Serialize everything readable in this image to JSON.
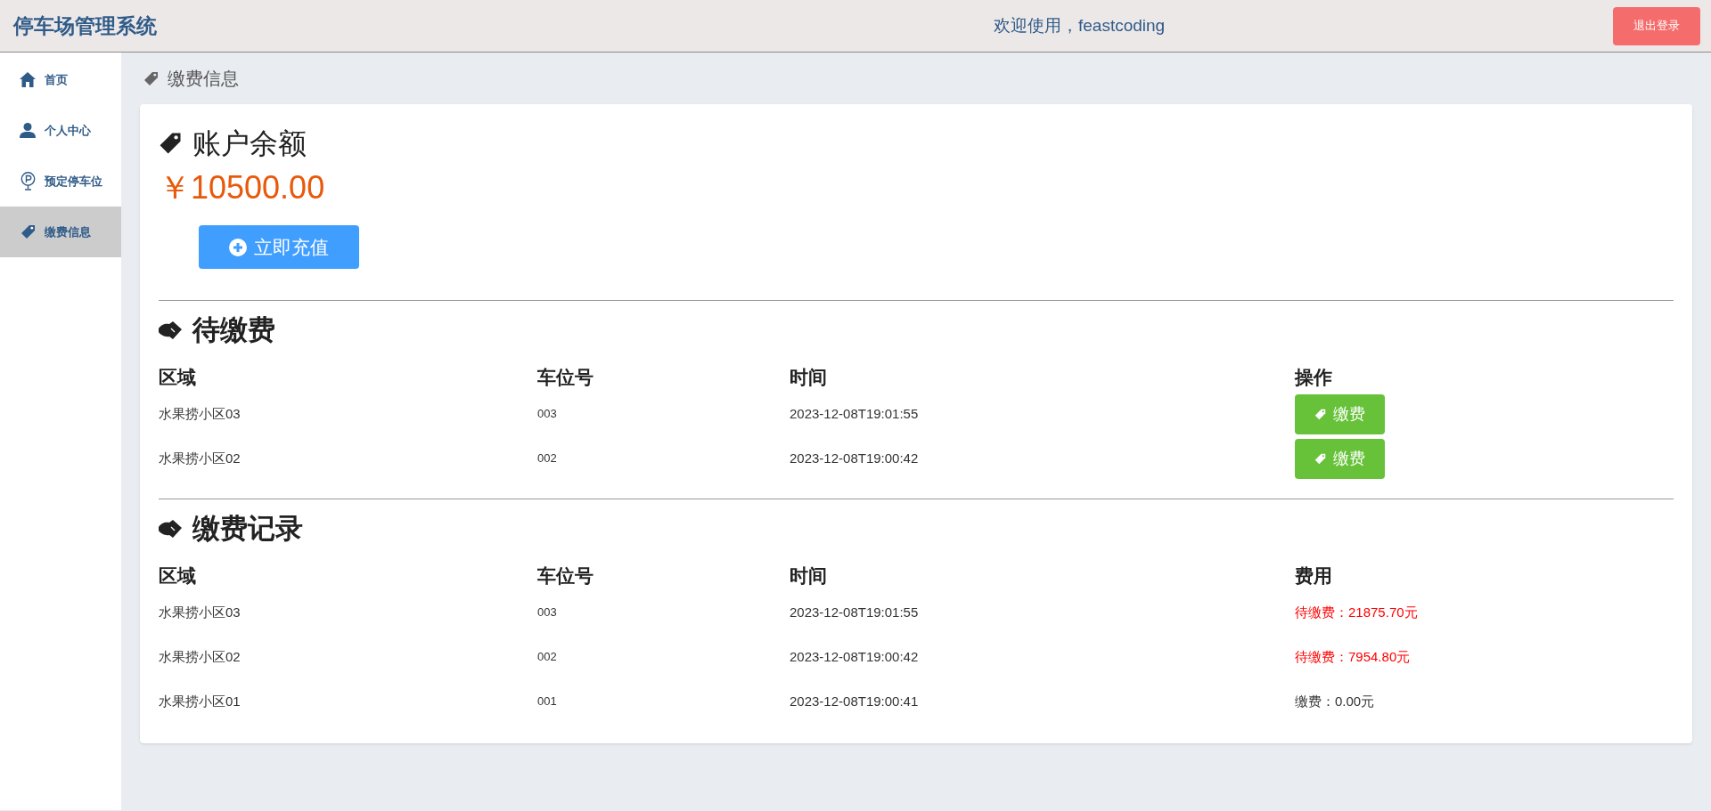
{
  "header": {
    "title": "停车场管理系统",
    "welcome": "欢迎使用，feastcoding",
    "logout_button": "退出登录"
  },
  "sidebar": {
    "items": [
      {
        "label": "首页",
        "kind": "home",
        "selected": false
      },
      {
        "label": "个人中心",
        "kind": "user",
        "selected": false
      },
      {
        "label": "预定停车位",
        "kind": "parking",
        "selected": false
      },
      {
        "label": "缴费信息",
        "kind": "tag",
        "selected": true
      }
    ]
  },
  "page_title": "缴费信息",
  "balance": {
    "title": "账户余额",
    "amount": "￥10500.00",
    "recharge_button": "立即充值"
  },
  "pending": {
    "title": "待缴费",
    "columns": [
      "区域",
      "车位号",
      "时间",
      "操作"
    ],
    "rows": [
      {
        "area": "水果捞小区03",
        "space": "003",
        "time": "2023-12-08T19:01:55",
        "action": "缴费"
      },
      {
        "area": "水果捞小区02",
        "space": "002",
        "time": "2023-12-08T19:00:42",
        "action": "缴费"
      }
    ]
  },
  "records": {
    "title": "缴费记录",
    "columns": [
      "区域",
      "车位号",
      "时间",
      "费用"
    ],
    "rows": [
      {
        "area": "水果捞小区03",
        "space": "003",
        "time": "2023-12-08T19:01:55",
        "fee": "待缴费：21875.70元",
        "unpaid": true
      },
      {
        "area": "水果捞小区02",
        "space": "002",
        "time": "2023-12-08T19:00:42",
        "fee": "待缴费：7954.80元",
        "unpaid": true
      },
      {
        "area": "水果捞小区01",
        "space": "001",
        "time": "2023-12-08T19:00:41",
        "fee": "缴费：0.00元",
        "unpaid": false
      }
    ]
  }
}
